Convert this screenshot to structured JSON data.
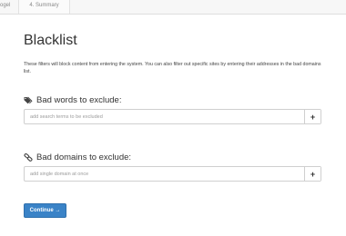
{
  "tabs": [
    {
      "label": "ogel"
    },
    {
      "label": "4. Summary"
    }
  ],
  "page": {
    "title": "Blacklist",
    "description": "These filters will block content from entering the system. You can also filter out specific sites by entering their addresses in the bad domains list."
  },
  "bad_words": {
    "heading": "Bad words to exclude:",
    "icon": "tags-icon",
    "placeholder": "add search terms to be excluded",
    "add_label": "+"
  },
  "bad_domains": {
    "heading": "Bad domains to exclude:",
    "icon": "link-icon",
    "placeholder": "add single domain at once",
    "add_label": "+"
  },
  "continue_label": "Continue →",
  "colors": {
    "primary_button": "#3a83c7",
    "border": "#cfcfcf"
  }
}
